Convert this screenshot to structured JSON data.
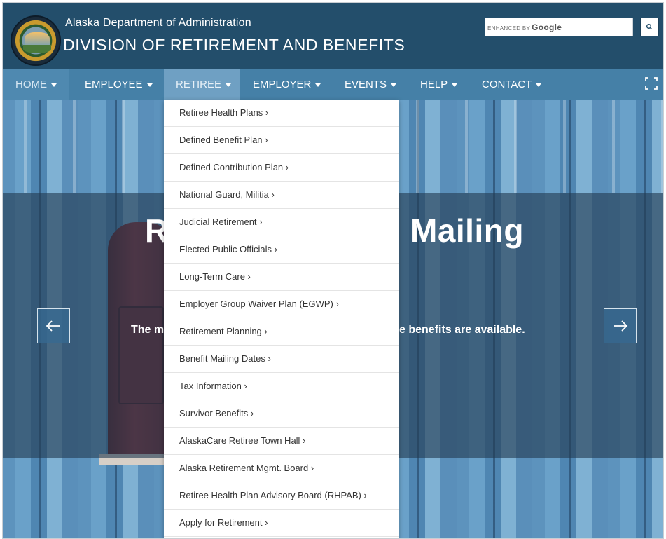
{
  "header": {
    "agency": "Alaska Department of Administration",
    "division": "DIVISION OF RETIREMENT AND BENEFITS",
    "seal_icon": "alaska-state-seal-logo"
  },
  "search": {
    "brand": "ENHANCED BY",
    "brand_name": "Google",
    "value": "",
    "button_icon": "search-icon"
  },
  "nav": {
    "home": "HOME",
    "employee": "EMPLOYEE",
    "retiree": "RETIREE",
    "employer": "EMPLOYER",
    "events": "EVENTS",
    "help": "HELP",
    "contact": "CONTACT",
    "expand_icon": "fullscreen-icon",
    "active": "RETIREE"
  },
  "retiree_menu": [
    "Retiree Health Plans ›",
    "Defined Benefit Plan ›",
    "Defined Contribution Plan ›",
    "National Guard, Militia ›",
    "Judicial Retirement ›",
    "Elected Public Officials ›",
    "Long-Term Care ›",
    "Employer Group Waiver Plan (EGWP) ›",
    "Retirement Planning ›",
    "Benefit Mailing Dates ›",
    "Tax Information ›",
    "Survivor Benefits ›",
    "AlaskaCare Retiree Town Hall ›",
    "Alaska Retirement Mgmt. Board ›",
    "Retiree Health Plan Advisory Board (RHPAB) ›",
    "Apply for Retirement ›"
  ],
  "hero": {
    "title_left": "R",
    "title_right": "Mailing",
    "subtitle_left": "The m",
    "subtitle_right": "e benefits are available.",
    "prev_icon": "arrow-left-icon",
    "next_icon": "arrow-right-icon"
  },
  "colors": {
    "header_bg": "#234e6b",
    "nav_bg": "#4580a7",
    "active_tab": "#6fa0c3"
  }
}
